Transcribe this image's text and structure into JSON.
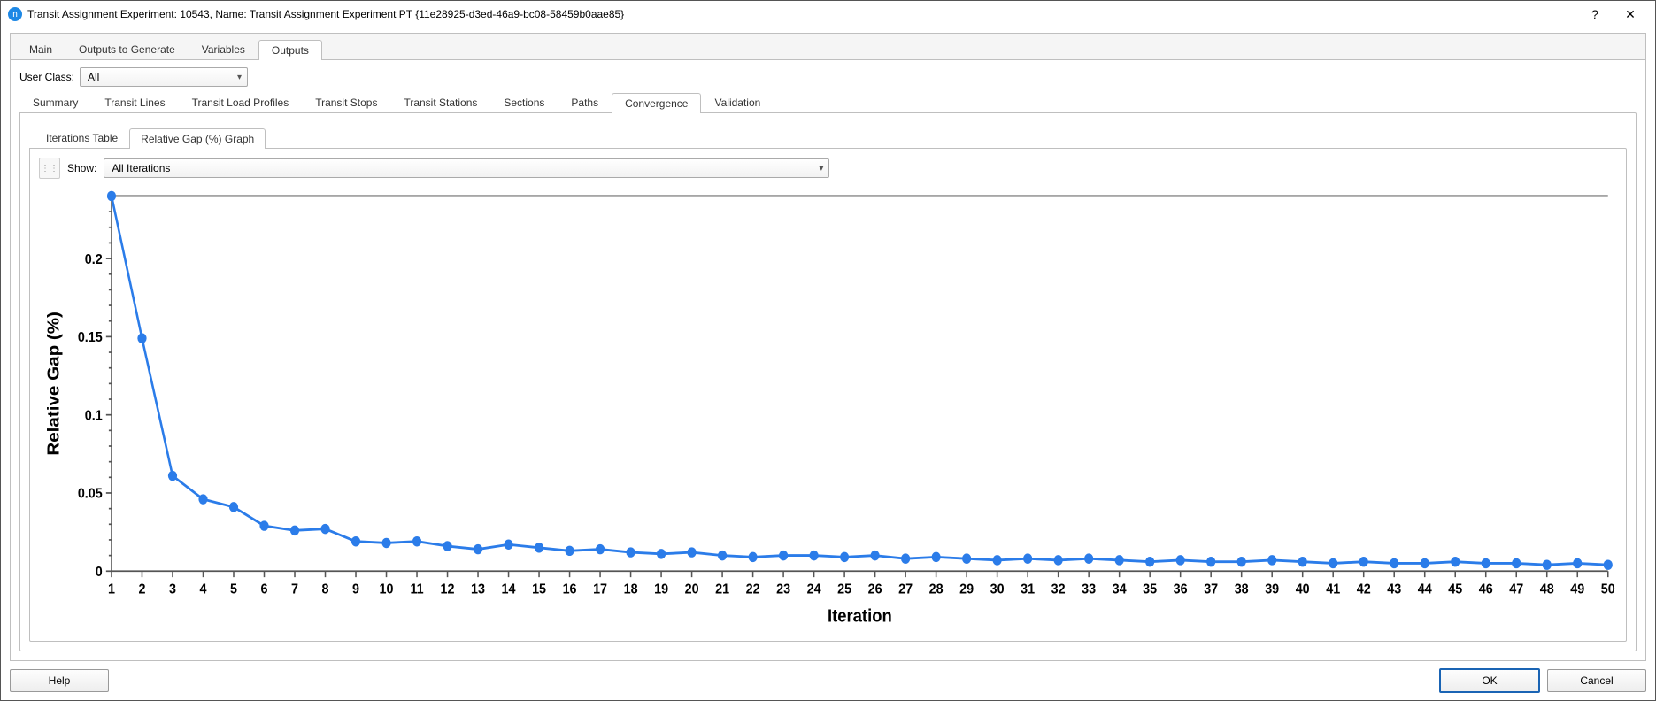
{
  "titlebar": {
    "icon_letter": "n",
    "title": "Transit Assignment Experiment: 10543, Name: Transit Assignment Experiment PT  {11e28925-d3ed-46a9-bc08-58459b0aae85}",
    "help": "?",
    "close": "✕"
  },
  "tabs": {
    "items": [
      {
        "label": "Main"
      },
      {
        "label": "Outputs to Generate"
      },
      {
        "label": "Variables"
      },
      {
        "label": "Outputs"
      }
    ],
    "active_index": 3
  },
  "user_class": {
    "label": "User Class:",
    "value": "All"
  },
  "subtabs": {
    "items": [
      {
        "label": "Summary"
      },
      {
        "label": "Transit Lines"
      },
      {
        "label": "Transit Load Profiles"
      },
      {
        "label": "Transit Stops"
      },
      {
        "label": "Transit Stations"
      },
      {
        "label": "Sections"
      },
      {
        "label": "Paths"
      },
      {
        "label": "Convergence"
      },
      {
        "label": "Validation"
      }
    ],
    "active_index": 7
  },
  "innertabs": {
    "items": [
      {
        "label": "Iterations Table"
      },
      {
        "label": "Relative Gap (%) Graph"
      }
    ],
    "active_index": 1
  },
  "show": {
    "label": "Show:",
    "value": "All Iterations"
  },
  "buttons": {
    "help": "Help",
    "ok": "OK",
    "cancel": "Cancel"
  },
  "chart_data": {
    "type": "line",
    "xlabel": "Iteration",
    "ylabel": "Relative Gap (%)",
    "xlim": [
      1,
      50
    ],
    "ylim": [
      0,
      0.24
    ],
    "yticks": [
      0,
      0.05,
      0.1,
      0.15,
      0.2
    ],
    "x": [
      1,
      2,
      3,
      4,
      5,
      6,
      7,
      8,
      9,
      10,
      11,
      12,
      13,
      14,
      15,
      16,
      17,
      18,
      19,
      20,
      21,
      22,
      23,
      24,
      25,
      26,
      27,
      28,
      29,
      30,
      31,
      32,
      33,
      34,
      35,
      36,
      37,
      38,
      39,
      40,
      41,
      42,
      43,
      44,
      45,
      46,
      47,
      48,
      49,
      50
    ],
    "values": [
      0.24,
      0.149,
      0.061,
      0.046,
      0.041,
      0.029,
      0.026,
      0.027,
      0.019,
      0.018,
      0.019,
      0.016,
      0.014,
      0.017,
      0.015,
      0.013,
      0.014,
      0.012,
      0.011,
      0.012,
      0.01,
      0.009,
      0.01,
      0.01,
      0.009,
      0.01,
      0.008,
      0.009,
      0.008,
      0.007,
      0.008,
      0.007,
      0.008,
      0.007,
      0.006,
      0.007,
      0.006,
      0.006,
      0.007,
      0.006,
      0.005,
      0.006,
      0.005,
      0.005,
      0.006,
      0.005,
      0.005,
      0.004,
      0.005,
      0.004
    ]
  }
}
